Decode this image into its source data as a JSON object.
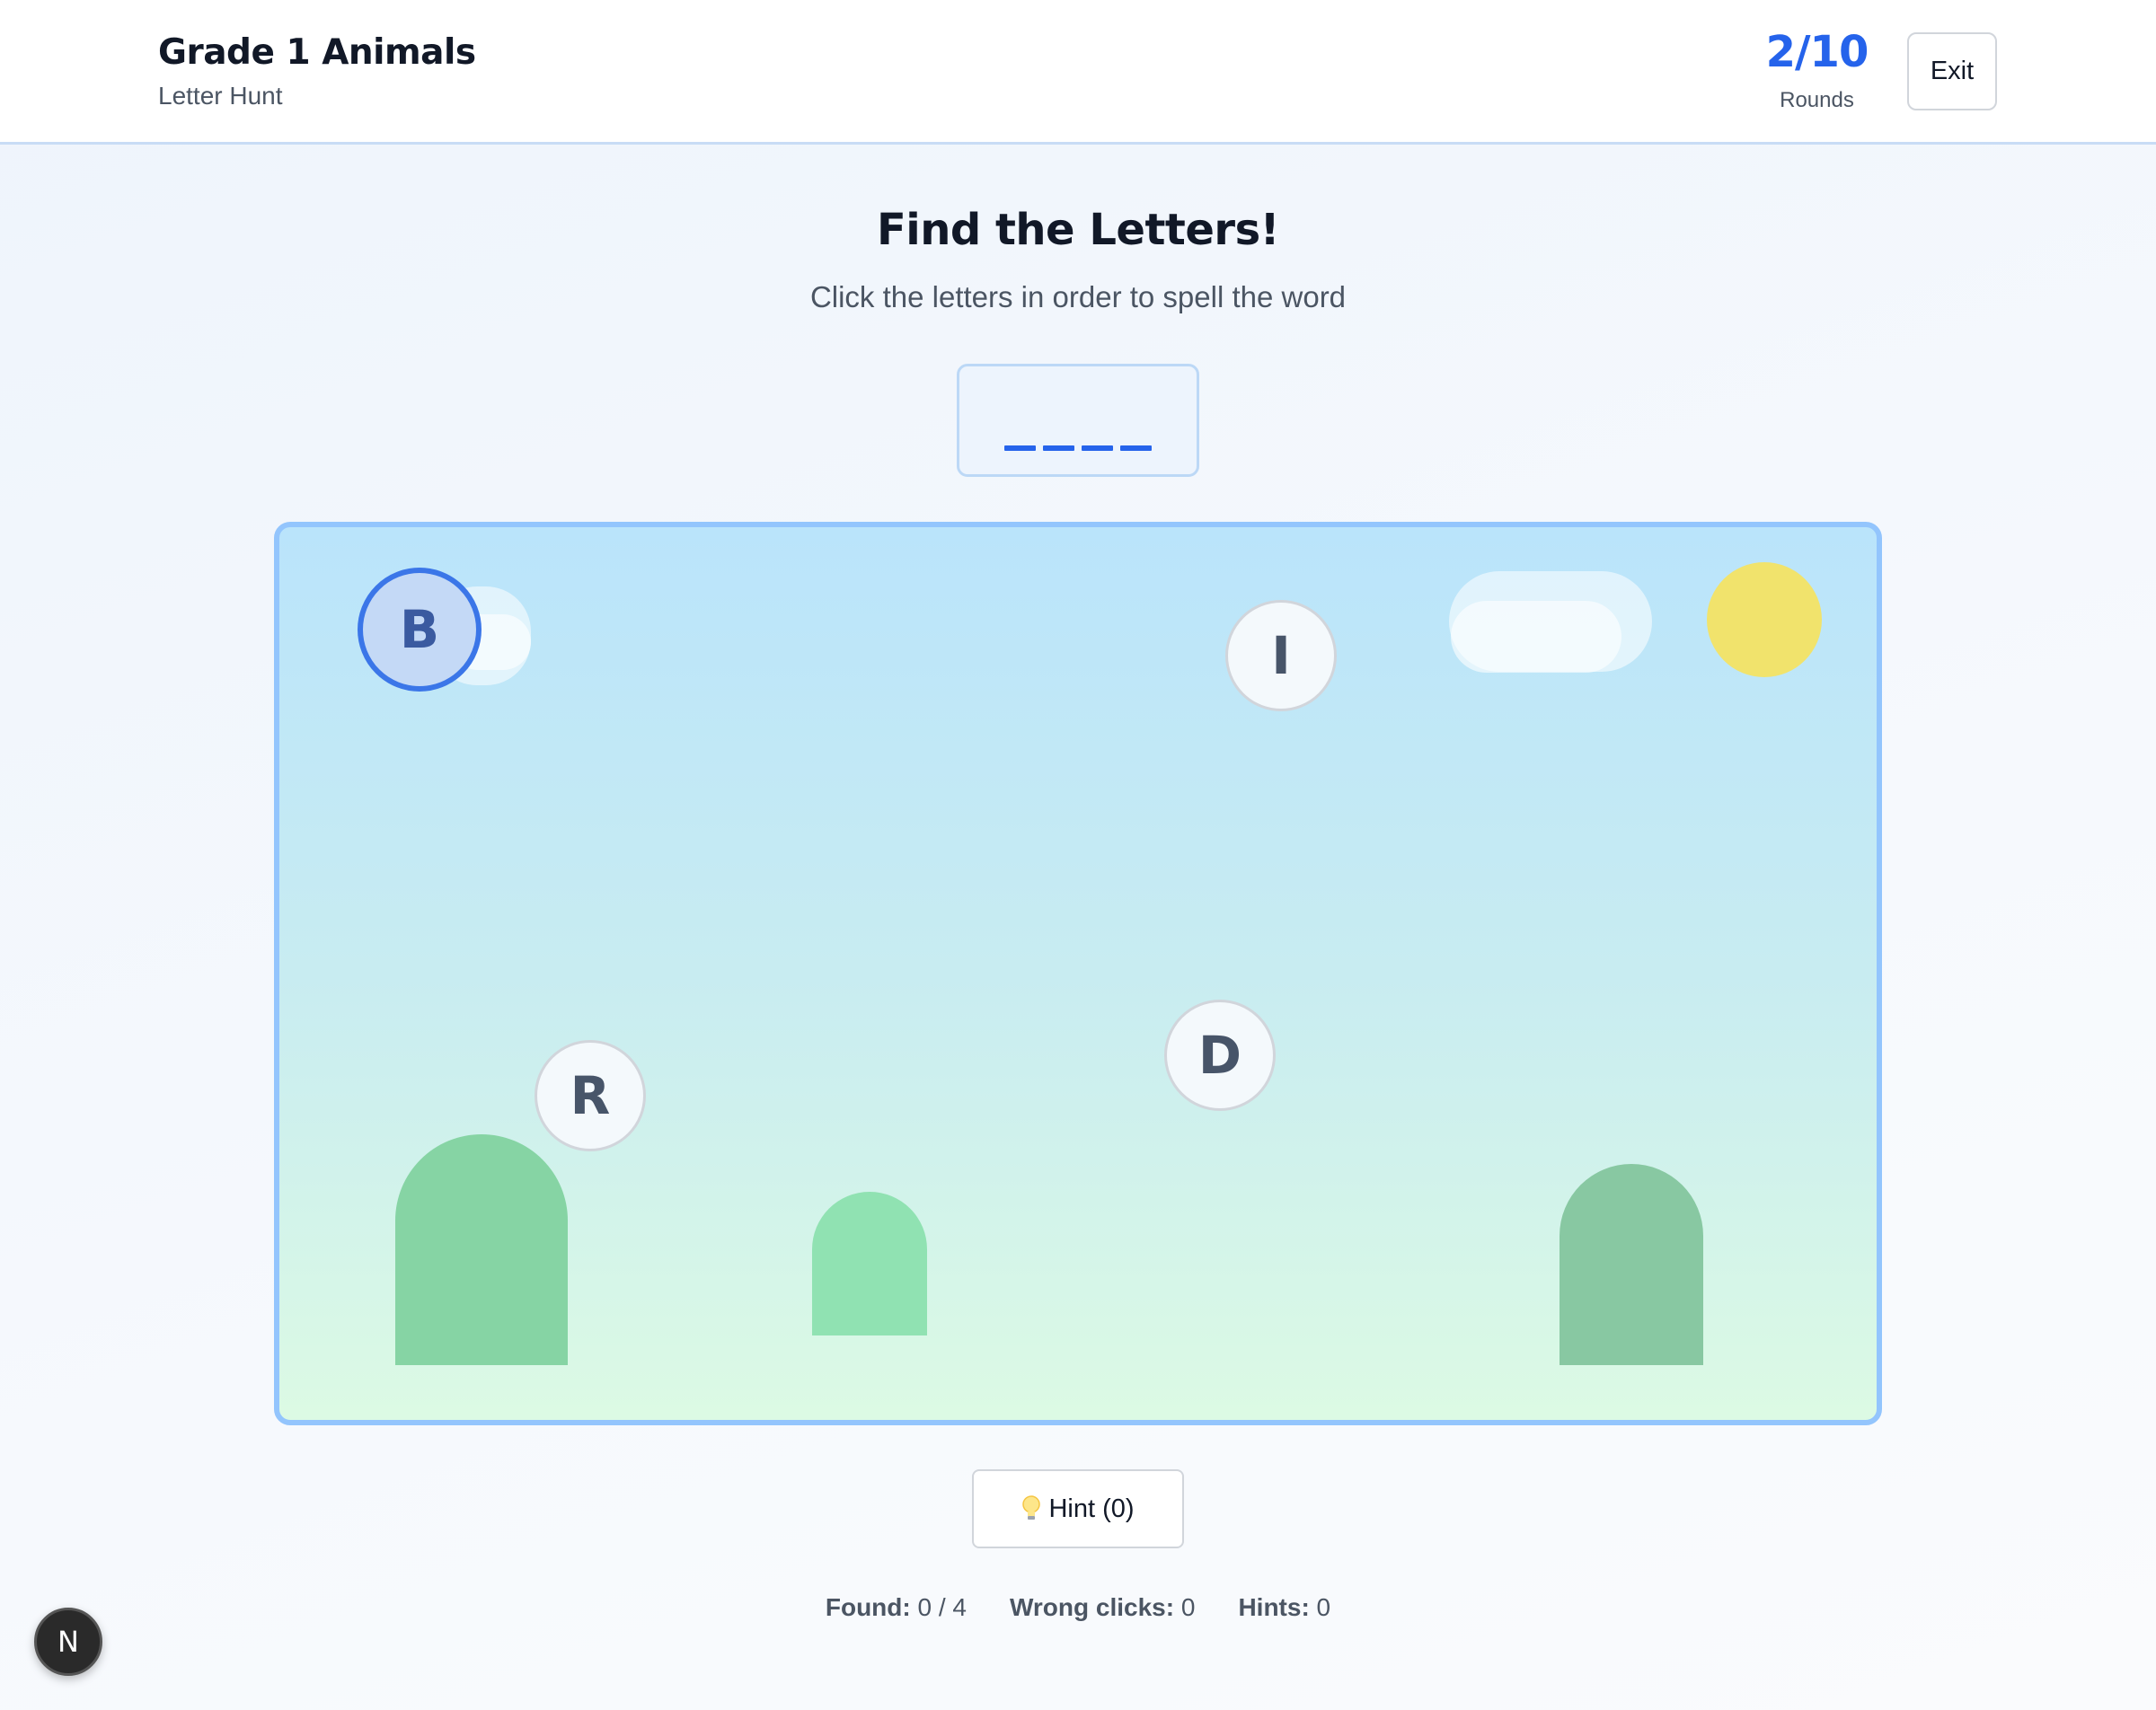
{
  "header": {
    "title": "Grade 1 Animals",
    "subtitle": "Letter Hunt",
    "rounds_value": "2/10",
    "rounds_label": "Rounds",
    "exit_label": "Exit"
  },
  "game": {
    "title": "Find the Letters!",
    "instructions": "Click the letters in order to spell the word",
    "word_slots": 4,
    "letters": [
      {
        "char": "B",
        "state": "highlighted"
      },
      {
        "char": "I",
        "state": "normal"
      },
      {
        "char": "R",
        "state": "normal"
      },
      {
        "char": "D",
        "state": "normal"
      }
    ],
    "scene_icons": [
      "cloud",
      "cloud",
      "sun",
      "bush",
      "bush",
      "bush"
    ]
  },
  "hint": {
    "icon": "lightbulb-icon",
    "label": "Hint (0)"
  },
  "stats": {
    "found_label": "Found:",
    "found_value": "0 / 4",
    "wrong_label": "Wrong clicks:",
    "wrong_value": "0",
    "hints_label": "Hints:",
    "hints_value": "0"
  },
  "badge": {
    "label": "N"
  },
  "colors": {
    "accent": "#2563eb",
    "scene_border": "#93c5fd",
    "sun": "#f1e36c",
    "bush": "#86d4a4"
  }
}
